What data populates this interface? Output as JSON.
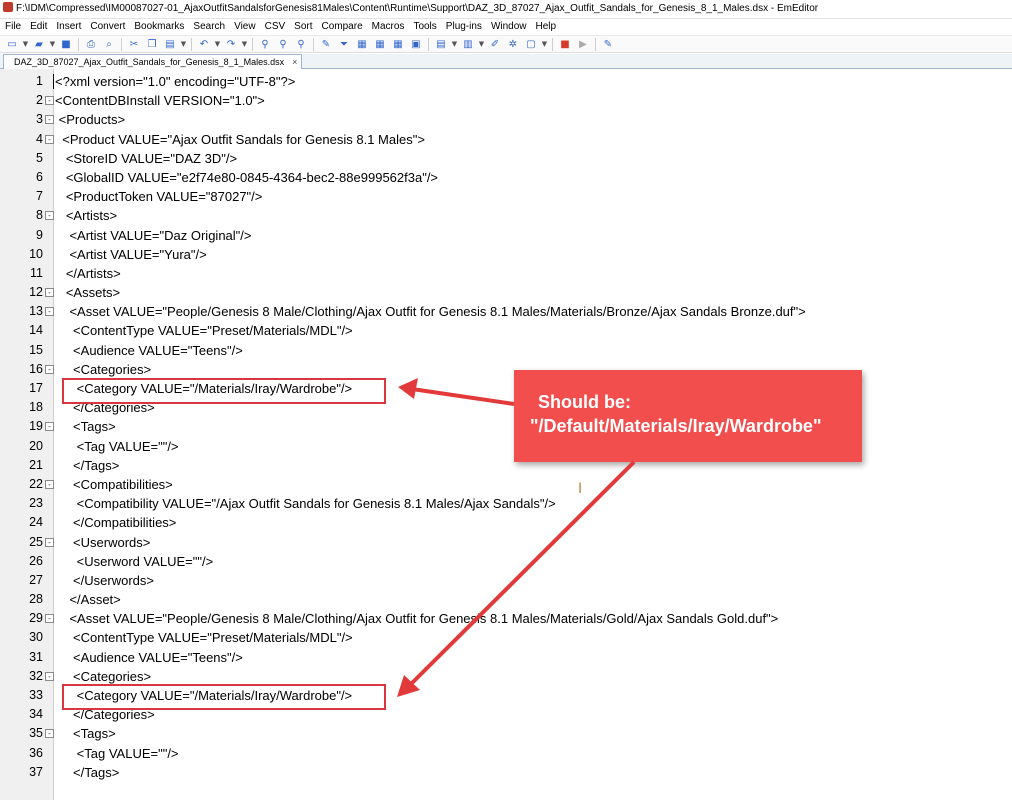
{
  "window": {
    "title": "F:\\IDM\\Compressed\\IM00087027-01_AjaxOutfitSandalsforGenesis81Males\\Content\\Runtime\\Support\\DAZ_3D_87027_Ajax_Outfit_Sandals_for_Genesis_8_1_Males.dsx - EmEditor"
  },
  "menu": [
    "File",
    "Edit",
    "Insert",
    "Convert",
    "Bookmarks",
    "Search",
    "View",
    "CSV",
    "Sort",
    "Compare",
    "Macros",
    "Tools",
    "Plug-ins",
    "Window",
    "Help"
  ],
  "tab": {
    "label": "DAZ_3D_87027_Ajax_Outfit_Sandals_for_Genesis_8_1_Males.dsx",
    "close": "×"
  },
  "editor": {
    "lines": [
      {
        "n": "1",
        "fold": "",
        "text": "<?xml version=\"1.0\" encoding=\"UTF-8\"?>"
      },
      {
        "n": "2",
        "fold": "-",
        "text": "<ContentDBInstall VERSION=\"1.0\">"
      },
      {
        "n": "3",
        "fold": "-",
        "text": " <Products>"
      },
      {
        "n": "4",
        "fold": "-",
        "text": "  <Product VALUE=\"Ajax Outfit Sandals for Genesis 8.1 Males\">"
      },
      {
        "n": "5",
        "fold": "",
        "text": "   <StoreID VALUE=\"DAZ 3D\"/>"
      },
      {
        "n": "6",
        "fold": "",
        "text": "   <GlobalID VALUE=\"e2f74e80-0845-4364-bec2-88e999562f3a\"/>"
      },
      {
        "n": "7",
        "fold": "",
        "text": "   <ProductToken VALUE=\"87027\"/>"
      },
      {
        "n": "8",
        "fold": "-",
        "text": "   <Artists>"
      },
      {
        "n": "9",
        "fold": "",
        "text": "    <Artist VALUE=\"Daz Original\"/>"
      },
      {
        "n": "10",
        "fold": "",
        "text": "    <Artist VALUE=\"Yura\"/>"
      },
      {
        "n": "11",
        "fold": "",
        "text": "   </Artists>"
      },
      {
        "n": "12",
        "fold": "-",
        "text": "   <Assets>"
      },
      {
        "n": "13",
        "fold": "-",
        "text": "    <Asset VALUE=\"People/Genesis 8 Male/Clothing/Ajax Outfit for Genesis 8.1 Males/Materials/Bronze/Ajax Sandals Bronze.duf\">"
      },
      {
        "n": "14",
        "fold": "",
        "text": "     <ContentType VALUE=\"Preset/Materials/MDL\"/>"
      },
      {
        "n": "15",
        "fold": "",
        "text": "     <Audience VALUE=\"Teens\"/>"
      },
      {
        "n": "16",
        "fold": "-",
        "text": "     <Categories>"
      },
      {
        "n": "17",
        "fold": "",
        "text": "      <Category VALUE=\"/Materials/Iray/Wardrobe\"/>"
      },
      {
        "n": "18",
        "fold": "",
        "text": "     </Categories>"
      },
      {
        "n": "19",
        "fold": "-",
        "text": "     <Tags>"
      },
      {
        "n": "20",
        "fold": "",
        "text": "      <Tag VALUE=\"\"/>"
      },
      {
        "n": "21",
        "fold": "",
        "text": "     </Tags>"
      },
      {
        "n": "22",
        "fold": "-",
        "text": "     <Compatibilities>"
      },
      {
        "n": "23",
        "fold": "",
        "text": "      <Compatibility VALUE=\"/Ajax Outfit Sandals for Genesis 8.1 Males/Ajax Sandals\"/>"
      },
      {
        "n": "24",
        "fold": "",
        "text": "     </Compatibilities>"
      },
      {
        "n": "25",
        "fold": "-",
        "text": "     <Userwords>"
      },
      {
        "n": "26",
        "fold": "",
        "text": "      <Userword VALUE=\"\"/>"
      },
      {
        "n": "27",
        "fold": "",
        "text": "     </Userwords>"
      },
      {
        "n": "28",
        "fold": "",
        "text": "    </Asset>"
      },
      {
        "n": "29",
        "fold": "-",
        "text": "    <Asset VALUE=\"People/Genesis 8 Male/Clothing/Ajax Outfit for Genesis 8.1 Males/Materials/Gold/Ajax Sandals Gold.duf\">"
      },
      {
        "n": "30",
        "fold": "",
        "text": "     <ContentType VALUE=\"Preset/Materials/MDL\"/>"
      },
      {
        "n": "31",
        "fold": "",
        "text": "     <Audience VALUE=\"Teens\"/>"
      },
      {
        "n": "32",
        "fold": "-",
        "text": "     <Categories>"
      },
      {
        "n": "33",
        "fold": "",
        "text": "      <Category VALUE=\"/Materials/Iray/Wardrobe\"/>"
      },
      {
        "n": "34",
        "fold": "",
        "text": "     </Categories>"
      },
      {
        "n": "35",
        "fold": "-",
        "text": "     <Tags>"
      },
      {
        "n": "36",
        "fold": "",
        "text": "      <Tag VALUE=\"\"/>"
      },
      {
        "n": "37",
        "fold": "",
        "text": "     </Tags>"
      }
    ]
  },
  "annotation": {
    "line1": "Should be:",
    "line2": "\"/Default/Materials/Iray/Wardrobe\"",
    "color": "#f24e4e"
  }
}
